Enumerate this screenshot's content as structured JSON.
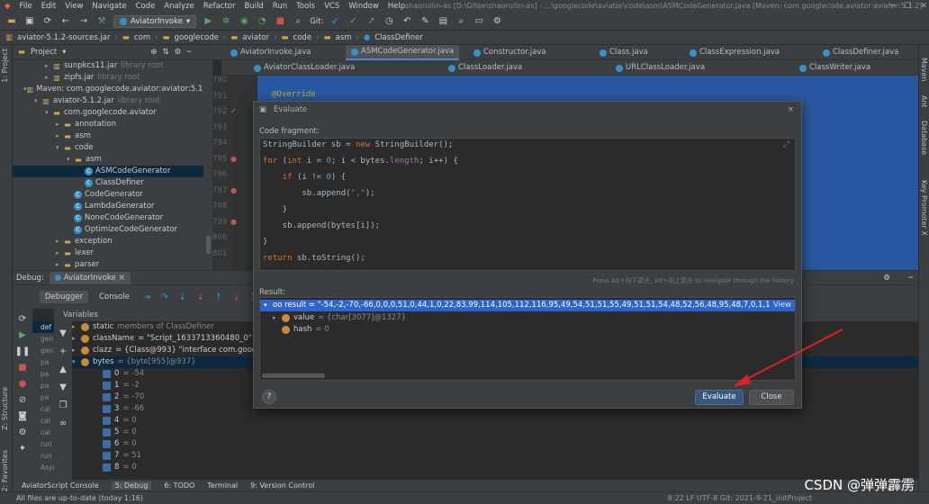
{
  "menubar": {
    "items": [
      "File",
      "Edit",
      "View",
      "Navigate",
      "Code",
      "Analyze",
      "Refactor",
      "Build",
      "Run",
      "Tools",
      "VCS",
      "Window",
      "Help"
    ],
    "title": "shaoruilin-as [D:\\Gitee\\shaoruilin-as] - ...\\googlecode\\aviator\\code\\asm\\ASMCodeGenerator.java [Maven: com.googlecode.aviator:aviator:5.1.2]"
  },
  "toolbar": {
    "run_config": "AviatorInvoke",
    "git_label": "Git:"
  },
  "breadcrumbs": [
    "aviator-5.1.2-sources.jar",
    "com",
    "googlecode",
    "aviator",
    "code",
    "asm",
    "ClassDefiner"
  ],
  "project": {
    "header": "Project",
    "tree": [
      {
        "label": "sunpkcs11.jar",
        "suffix": "library root",
        "indent": 3,
        "kind": "lib"
      },
      {
        "label": "zipfs.jar",
        "suffix": "library root",
        "indent": 3,
        "kind": "lib"
      },
      {
        "label": "Maven: com.googlecode.aviator:aviator:5.1.2",
        "suffix": "",
        "indent": 1,
        "kind": "lib",
        "open": true
      },
      {
        "label": "aviator-5.1.2.jar",
        "suffix": "library root",
        "indent": 2,
        "kind": "lib",
        "open": true
      },
      {
        "label": "com.googlecode.aviator",
        "suffix": "",
        "indent": 3,
        "kind": "pkg",
        "open": true
      },
      {
        "label": "annotation",
        "suffix": "",
        "indent": 4,
        "kind": "pkg"
      },
      {
        "label": "asm",
        "suffix": "",
        "indent": 4,
        "kind": "pkg"
      },
      {
        "label": "code",
        "suffix": "",
        "indent": 4,
        "kind": "pkg",
        "open": true
      },
      {
        "label": "asm",
        "suffix": "",
        "indent": 5,
        "kind": "pkg",
        "open": true
      },
      {
        "label": "ASMCodeGenerator",
        "suffix": "",
        "indent": 6,
        "kind": "class",
        "sel": true
      },
      {
        "label": "ClassDefiner",
        "suffix": "",
        "indent": 6,
        "kind": "class"
      },
      {
        "label": "CodeGenerator",
        "suffix": "",
        "indent": 5,
        "kind": "class"
      },
      {
        "label": "LambdaGenerator",
        "suffix": "",
        "indent": 5,
        "kind": "class"
      },
      {
        "label": "NoneCodeGenerator",
        "suffix": "",
        "indent": 5,
        "kind": "class"
      },
      {
        "label": "OptimizeCodeGenerator",
        "suffix": "",
        "indent": 5,
        "kind": "class"
      },
      {
        "label": "exception",
        "suffix": "",
        "indent": 4,
        "kind": "pkg"
      },
      {
        "label": "lexer",
        "suffix": "",
        "indent": 4,
        "kind": "pkg"
      },
      {
        "label": "parser",
        "suffix": "",
        "indent": 4,
        "kind": "pkg"
      }
    ]
  },
  "editor_tabs_row1": [
    "AviatorInvoke.java",
    "ASMCodeGenerator.java",
    "Constructor.java",
    "Class.java",
    "ClassExpression.java",
    "ClassDefiner.java"
  ],
  "editor_tabs_row2": [
    "AviatorClassLoader.java",
    "ClassLoader.java",
    "URLClassLoader.java",
    "ClassWriter.java"
  ],
  "editor": {
    "line_numbers": [
      "790",
      "791",
      "792",
      "793",
      "794",
      "795",
      "796",
      "797",
      "798",
      "799",
      "800",
      "801"
    ],
    "annotation": "@Override"
  },
  "debug": {
    "label": "Debug:",
    "session_tab": "AviatorInvoke",
    "tabs": [
      "Debugger",
      "Console"
    ],
    "variables_header": "Variables",
    "frames": [
      "def",
      "gen",
      "gen",
      "pa",
      "pa",
      "pa",
      "pa",
      "cal",
      "cal",
      "cal",
      "run",
      "run",
      "Async"
    ],
    "variables": [
      {
        "name": "static",
        "value": "members of ClassDefiner",
        "kind": "f",
        "indent": 0,
        "tri": "▸"
      },
      {
        "name": "className",
        "value": "= \"Script_1633713360480_0\"",
        "kind": "f",
        "indent": 0,
        "tri": "▸"
      },
      {
        "name": "clazz",
        "value": "= {Class@993} \"interface com.googlecode.aviator...",
        "kind": "f",
        "indent": 0,
        "tri": "▸"
      },
      {
        "name": "bytes",
        "value": "= {byte[955]@937}",
        "kind": "f",
        "indent": 0,
        "tri": "▾",
        "sel": true
      },
      {
        "name": "0",
        "value": "= -54",
        "kind": "arr",
        "indent": 1,
        "tri": ""
      },
      {
        "name": "1",
        "value": "= -2",
        "kind": "arr",
        "indent": 1,
        "tri": ""
      },
      {
        "name": "2",
        "value": "= -70",
        "kind": "arr",
        "indent": 1,
        "tri": ""
      },
      {
        "name": "3",
        "value": "= -66",
        "kind": "arr",
        "indent": 1,
        "tri": ""
      },
      {
        "name": "4",
        "value": "= 0",
        "kind": "arr",
        "indent": 1,
        "tri": ""
      },
      {
        "name": "5",
        "value": "= 0",
        "kind": "arr",
        "indent": 1,
        "tri": ""
      },
      {
        "name": "6",
        "value": "= 0",
        "kind": "arr",
        "indent": 1,
        "tri": ""
      },
      {
        "name": "7",
        "value": "= 51",
        "kind": "arr",
        "indent": 1,
        "tri": ""
      },
      {
        "name": "8",
        "value": "= 0",
        "kind": "arr",
        "indent": 1,
        "tri": ""
      }
    ]
  },
  "left_strip": {
    "project": "1: Project",
    "structure": "Z: Structure",
    "favorites": "2: Favorites"
  },
  "right_strip": {
    "maven": "Maven",
    "ant": "Ant",
    "database": "Database",
    "promoter": "Key Promoter X"
  },
  "bottom_tabs": [
    "AviatorScript Console",
    "5: Debug",
    "6: TODO",
    "Terminal",
    "9: Version Control"
  ],
  "status": {
    "message": "All files are up-to-date (today 1:16)",
    "right": "8:22   LF   UTF-8   Git: 2021-9-21_initProject"
  },
  "dialog": {
    "title": "Evaluate",
    "code_label": "Code fragment:",
    "hint": "Press Alt+向下箭头, Alt+向上箭头 to navigate through the history",
    "result_label": "Result:",
    "result_value": "oo result = \"-54,-2,-70,-66,0,0,0,51,0,44,1,0,22,83,99,114,105,112,116,95,49,54,51,51,55,49,51,51,54,48,52,56,48,95,48,7,0,1,1,0,38,99,111,109,47,103,111,111,103...",
    "view_link": "View",
    "result_children": [
      {
        "name": "value",
        "value": "= {char[3077]@1327}"
      },
      {
        "name": "hash",
        "value": "= 0"
      }
    ],
    "evaluate_btn": "Evaluate",
    "close_btn": "Close",
    "help_btn": "?"
  },
  "watermark": "CSDN @弹弹霹雳"
}
